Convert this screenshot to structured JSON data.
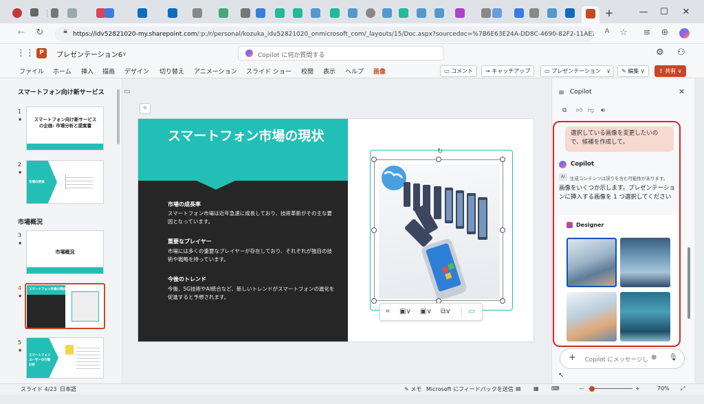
{
  "browser": {
    "url": "https://idv52821020-my.sharepoint.com/:p:/r/personal/kozuka_idv52821020_onmicrosoft_com/_layouts/15/Doc.aspx?sourcedoc=%7B6E63E24A-DD8C-4690-82F2-11AE1F719C0D%7D&file=...",
    "url_host": "https://idv52821020-my.sharepoint.com",
    "url_rest": "/:p:/r/personal/kozuka_idv52821020_onmicrosoft_com/_layouts/15/Doc.aspx?sourcedoc=%7B6E63E24A-DD8C-4690-82F2-11AE1F719C0D%7D&file=...",
    "new_tab": "+",
    "minimize": "—",
    "maximize": "☐",
    "close": "✕"
  },
  "app": {
    "title": "プレゼンテーション6",
    "search_placeholder": "Copilot に何か質問する"
  },
  "ribbon": {
    "tabs": [
      "ファイル",
      "ホーム",
      "挿入",
      "描画",
      "デザイン",
      "切り替え",
      "アニメーション",
      "スライド ショー",
      "校閲",
      "表示",
      "ヘルプ",
      "画像"
    ],
    "active_tab": "画像",
    "comment": "コメント",
    "catchup": "キャッチアップ",
    "present": "プレゼンテーション",
    "edit": "編集",
    "share": "共有"
  },
  "thumbnails": {
    "section1": "スマートフォン向け新サービス",
    "section2": "市場概況",
    "items": [
      {
        "num": "1",
        "title": "スマートフォン向け新サービスの企画: 市場分析と提案書"
      },
      {
        "num": "2",
        "title": "市場の評価"
      },
      {
        "num": "3",
        "title": "市場概況"
      },
      {
        "num": "4",
        "title": "スマートフォン市場の現状"
      },
      {
        "num": "5",
        "title": "スマートフォンユーザーの行動分析"
      }
    ]
  },
  "slide": {
    "title": "スマートフォン市場の現状",
    "sections": [
      {
        "heading": "市場の成長率",
        "body": "スマートフォン市場は近年急速に成長しており、技術革新がその主な要因となっています。"
      },
      {
        "heading": "重要なプレイヤー",
        "body": "市場には多くの重要なプレイヤーが存在しており、それぞれが独自の技術や戦略を持っています。"
      },
      {
        "heading": "今後のトレンド",
        "body": "今後、5G技術やAI統合など、新しいトレンドがスマートフォンの進化を促進すると予想されます。"
      }
    ]
  },
  "copilot": {
    "title": "Copilot",
    "user_message": "選択している画像を変更したいので、候補を作成して。",
    "assistant_name": "Copilot",
    "ai_badge": "AI",
    "ai_notice": "生成コンテンツは誤りを含む可能性があります。",
    "response": "画像をいくつか示します。プレゼンテーションに挿入する画像を 1 つ選択してください",
    "designer_label": "Designer",
    "input_placeholder": "Copilot にメッセージし"
  },
  "statusbar": {
    "slide_info": "スライド 4/23",
    "language": "日本語",
    "notes": "メモ",
    "feedback": "Microsoft にフィードバックを送信",
    "zoom": "70%"
  },
  "colors": {
    "accent_teal": "#23bfb6",
    "ppt_orange": "#c24c1f",
    "highlight_red": "#d7262b",
    "share_button": "#c8452a"
  }
}
